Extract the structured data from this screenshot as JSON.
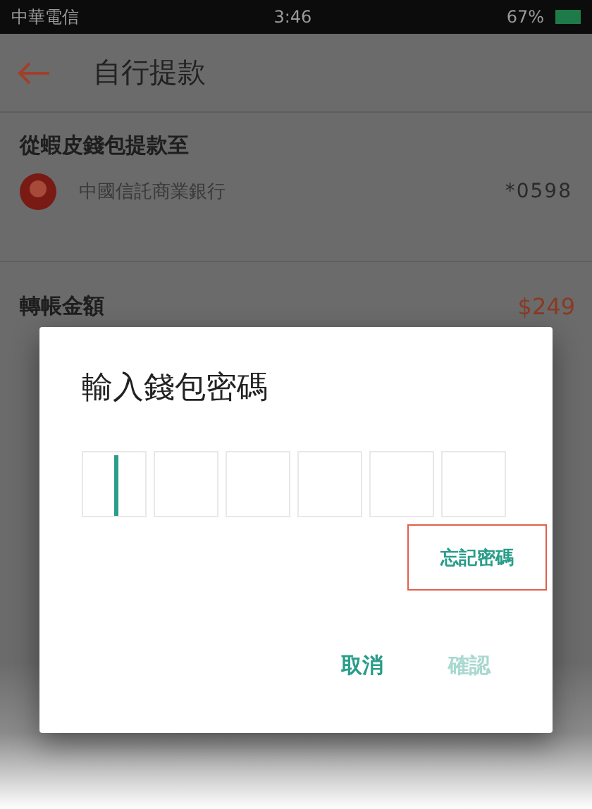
{
  "status_bar": {
    "carrier": "中華電信",
    "time": "3:46",
    "battery": "67%"
  },
  "header": {
    "title": "自行提款"
  },
  "source": {
    "label": "從蝦皮錢包提款至",
    "bank": "中國信託商業銀行",
    "account": "*0598"
  },
  "amount": {
    "label": "轉帳金額",
    "value": "$249"
  },
  "dialog": {
    "title": "輸入錢包密碼",
    "pin_boxes": [
      {
        "focused": true
      },
      {
        "focused": false
      },
      {
        "focused": false
      },
      {
        "focused": false
      },
      {
        "focused": false
      },
      {
        "focused": false
      }
    ],
    "forgot": {
      "label": "忘記密碼",
      "highlighted": true
    },
    "buttons": [
      {
        "label": "取消",
        "disabled": false
      },
      {
        "label": "確認",
        "disabled": true
      }
    ]
  }
}
